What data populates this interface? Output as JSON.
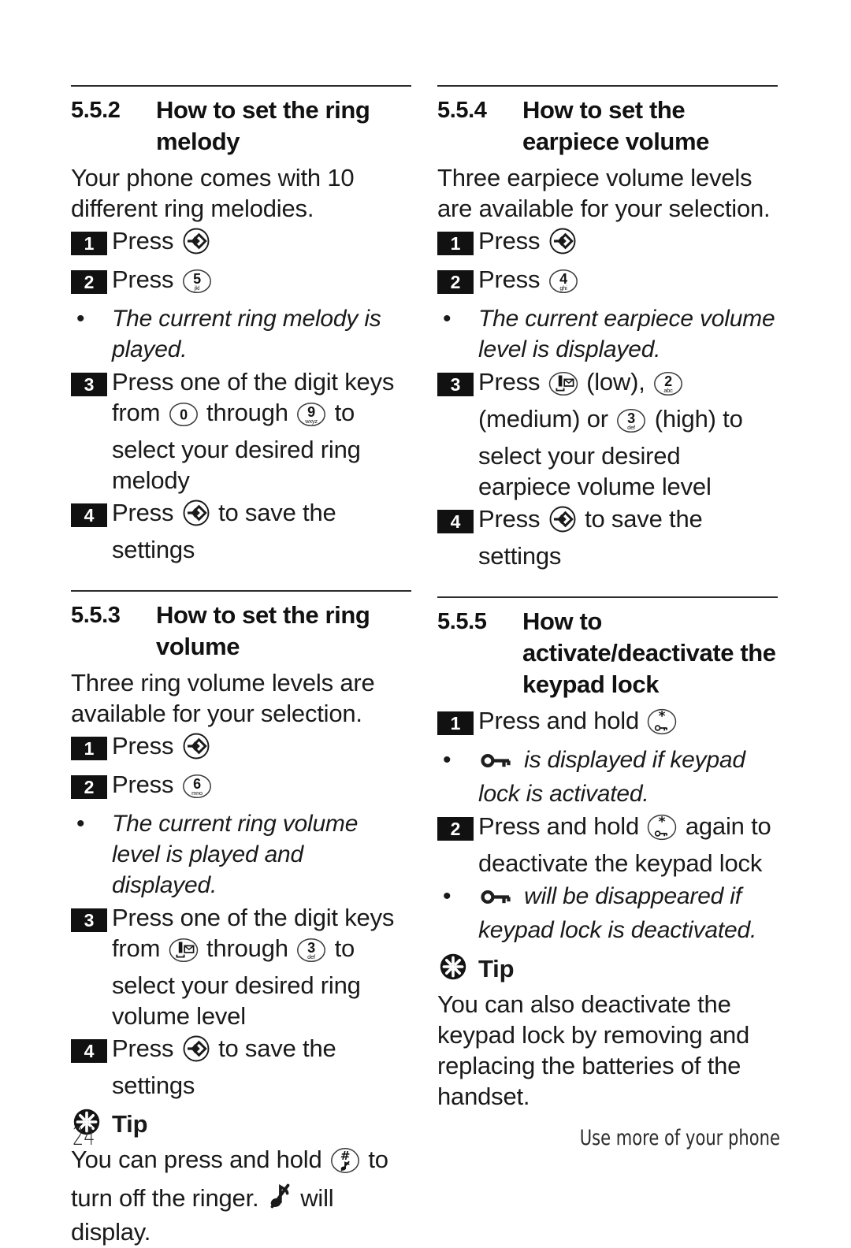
{
  "document": {
    "type": "cordless-phone-user-manual-page",
    "page_number": "24",
    "footer_note": "Use more of your phone"
  },
  "icons": {
    "menu_ok_key": "menu-key-icon",
    "bullet": "•",
    "tip": "tip-asterisk-icon",
    "key_lock": "key-icon",
    "ringer_off": "ringer-off-music-note-icon"
  },
  "left_column": {
    "sections": [
      {
        "number": "5.5.2",
        "title": "How to set the ring melody",
        "intro": "Your phone comes with 10 different ring melodies.",
        "steps": [
          {
            "marker": "1",
            "parts": [
              {
                "t": "text",
                "v": "Press "
              },
              {
                "t": "key",
                "v": "menu"
              }
            ]
          },
          {
            "marker": "2",
            "parts": [
              {
                "t": "text",
                "v": "Press "
              },
              {
                "t": "key",
                "v": "5"
              }
            ]
          },
          {
            "marker": "bullet",
            "italic": true,
            "parts": [
              {
                "t": "text",
                "v": "The current ring melody is played."
              }
            ]
          },
          {
            "marker": "3",
            "parts": [
              {
                "t": "text",
                "v": "Press one of the digit keys from "
              },
              {
                "t": "key",
                "v": "0"
              },
              {
                "t": "text",
                "v": " through "
              },
              {
                "t": "key",
                "v": "9"
              },
              {
                "t": "text",
                "v": " to select your desired ring melody"
              }
            ]
          },
          {
            "marker": "4",
            "parts": [
              {
                "t": "text",
                "v": "Press "
              },
              {
                "t": "key",
                "v": "menu"
              },
              {
                "t": "text",
                "v": " to save the settings"
              }
            ]
          }
        ]
      },
      {
        "number": "5.5.3",
        "title": "How to set the ring volume",
        "intro": "Three ring volume levels are available for your selection.",
        "steps": [
          {
            "marker": "1",
            "parts": [
              {
                "t": "text",
                "v": "Press "
              },
              {
                "t": "key",
                "v": "menu"
              }
            ]
          },
          {
            "marker": "2",
            "parts": [
              {
                "t": "text",
                "v": "Press "
              },
              {
                "t": "key",
                "v": "6"
              }
            ]
          },
          {
            "marker": "bullet",
            "italic": true,
            "parts": [
              {
                "t": "text",
                "v": "The current ring volume level is played and displayed."
              }
            ]
          },
          {
            "marker": "3",
            "parts": [
              {
                "t": "text",
                "v": "Press one of the digit keys from "
              },
              {
                "t": "key",
                "v": "1"
              },
              {
                "t": "text",
                "v": " through "
              },
              {
                "t": "key",
                "v": "3"
              },
              {
                "t": "text",
                "v": " to select your desired ring volume level"
              }
            ]
          },
          {
            "marker": "4",
            "parts": [
              {
                "t": "text",
                "v": "Press "
              },
              {
                "t": "key",
                "v": "menu"
              },
              {
                "t": "text",
                "v": " to save the settings"
              }
            ]
          }
        ],
        "tip": {
          "label": "Tip",
          "parts": [
            {
              "t": "text",
              "v": "You can press and hold "
            },
            {
              "t": "key",
              "v": "hash"
            },
            {
              "t": "text",
              "v": " to turn off the ringer. "
            },
            {
              "t": "glyph",
              "v": "ringer_off"
            },
            {
              "t": "text",
              "v": "  will display."
            }
          ]
        }
      }
    ]
  },
  "right_column": {
    "sections": [
      {
        "number": "5.5.4",
        "title": "How to set the earpiece volume",
        "intro": "Three earpiece volume levels are available for your selection.",
        "steps": [
          {
            "marker": "1",
            "parts": [
              {
                "t": "text",
                "v": "Press "
              },
              {
                "t": "key",
                "v": "menu"
              }
            ]
          },
          {
            "marker": "2",
            "parts": [
              {
                "t": "text",
                "v": "Press "
              },
              {
                "t": "key",
                "v": "4"
              }
            ]
          },
          {
            "marker": "bullet",
            "italic": true,
            "parts": [
              {
                "t": "text",
                "v": "The current earpiece volume level is displayed."
              }
            ]
          },
          {
            "marker": "3",
            "parts": [
              {
                "t": "text",
                "v": "Press "
              },
              {
                "t": "key",
                "v": "1"
              },
              {
                "t": "text",
                "v": " (low), "
              },
              {
                "t": "key",
                "v": "2"
              },
              {
                "t": "text",
                "v": " (medium) or "
              },
              {
                "t": "key",
                "v": "3"
              },
              {
                "t": "text",
                "v": " (high) to select your desired earpiece volume level"
              }
            ]
          },
          {
            "marker": "4",
            "parts": [
              {
                "t": "text",
                "v": "Press "
              },
              {
                "t": "key",
                "v": "menu"
              },
              {
                "t": "text",
                "v": " to save the settings"
              }
            ]
          }
        ]
      },
      {
        "number": "5.5.5",
        "title": "How to activate/deactivate the keypad lock",
        "steps": [
          {
            "marker": "1",
            "parts": [
              {
                "t": "text",
                "v": "Press and hold "
              },
              {
                "t": "key",
                "v": "star"
              }
            ]
          },
          {
            "marker": "bullet",
            "italic": true,
            "parts": [
              {
                "t": "glyph",
                "v": "key_lock"
              },
              {
                "t": "text",
                "v": " is displayed if keypad lock is activated."
              }
            ]
          },
          {
            "marker": "2",
            "parts": [
              {
                "t": "text",
                "v": "Press and hold "
              },
              {
                "t": "key",
                "v": "star"
              },
              {
                "t": "text",
                "v": " again to deactivate the keypad lock"
              }
            ]
          },
          {
            "marker": "bullet",
            "italic": true,
            "parts": [
              {
                "t": "glyph",
                "v": "key_lock"
              },
              {
                "t": "text",
                "v": " will be disappeared if keypad lock is deactivated."
              }
            ]
          }
        ],
        "tip": {
          "label": "Tip",
          "parts": [
            {
              "t": "text",
              "v": "You can also deactivate the keypad lock by removing and replacing the batteries of the handset."
            }
          ]
        }
      }
    ]
  },
  "keycaps": {
    "menu": {
      "name": "menu-ok-key",
      "digit": "",
      "letters": ""
    },
    "0": {
      "name": "digit-0-key",
      "digit": "0",
      "letters": ""
    },
    "1": {
      "name": "digit-1-voicemail-key",
      "digit": "1",
      "letters": ""
    },
    "2": {
      "name": "digit-2-key",
      "digit": "2",
      "letters": "abc"
    },
    "3": {
      "name": "digit-3-key",
      "digit": "3",
      "letters": "def"
    },
    "4": {
      "name": "digit-4-key",
      "digit": "4",
      "letters": "ghi"
    },
    "5": {
      "name": "digit-5-key",
      "digit": "5",
      "letters": "jkl"
    },
    "6": {
      "name": "digit-6-key",
      "digit": "6",
      "letters": "mno"
    },
    "9": {
      "name": "digit-9-key",
      "digit": "9",
      "letters": "wxyz"
    },
    "star": {
      "name": "star-keypad-lock-key",
      "digit": "*",
      "letters": ""
    },
    "hash": {
      "name": "hash-ringer-off-key",
      "digit": "#",
      "letters": ""
    }
  },
  "colors": {
    "ink": "#1a1a1a",
    "rule": "#2b2b2b",
    "marker_bg": "#111111",
    "marker_fg": "#ffffff",
    "paper": "#ffffff"
  }
}
